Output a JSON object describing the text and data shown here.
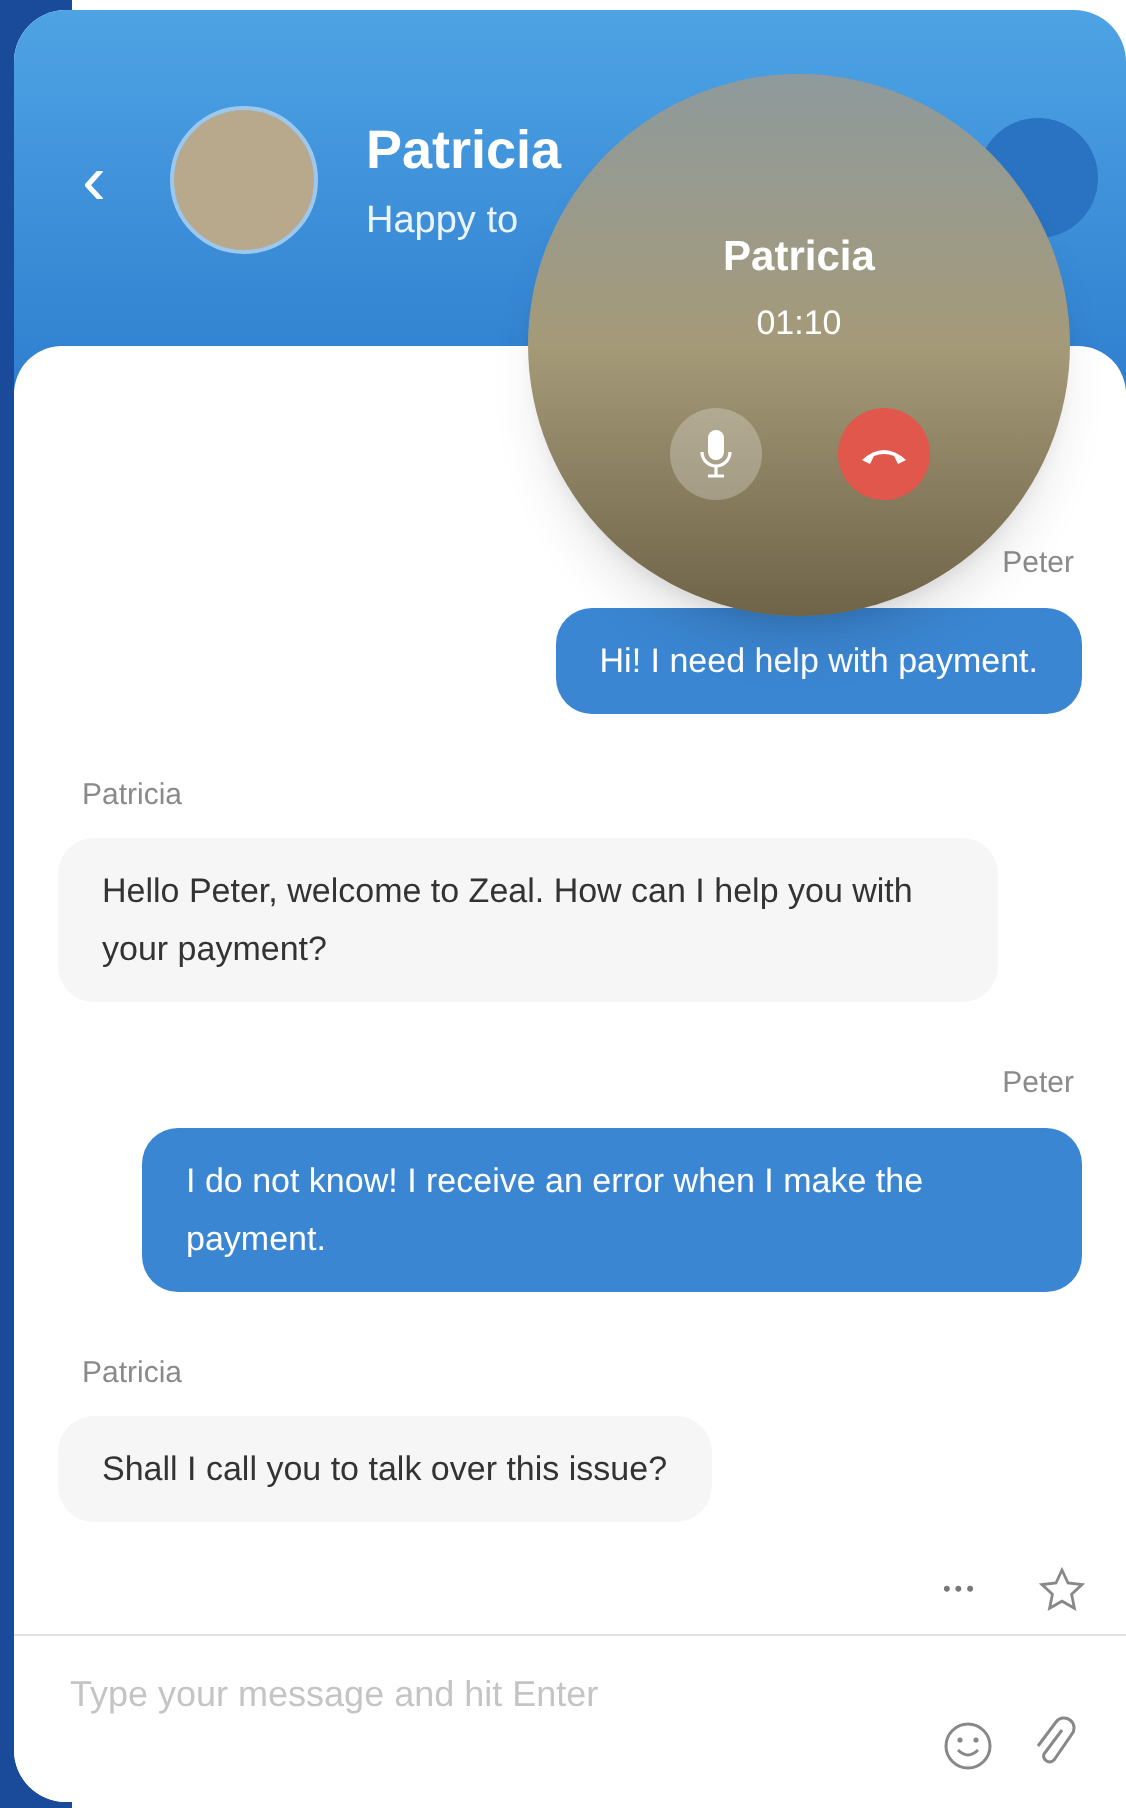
{
  "header": {
    "back": "‹",
    "name": "Patricia",
    "status": "Happy to"
  },
  "call": {
    "name": "Patricia",
    "duration": "01:10",
    "muted": false
  },
  "messages": [
    {
      "kind": "sent",
      "sender": "Peter",
      "text": "Hi! I need help with payment."
    },
    {
      "kind": "received",
      "sender": "Patricia",
      "text": "Hello Peter, welcome to Zeal. How can I help you with your payment?"
    },
    {
      "kind": "sent",
      "sender": "Peter",
      "text": "I do not know! I receive an error when I make the payment."
    },
    {
      "kind": "received",
      "sender": "Patricia",
      "text": "Shall I call you to talk over this issue?"
    }
  ],
  "actions": {
    "more": "•••",
    "starred": false
  },
  "composer": {
    "placeholder": "Type your message and hit Enter"
  }
}
